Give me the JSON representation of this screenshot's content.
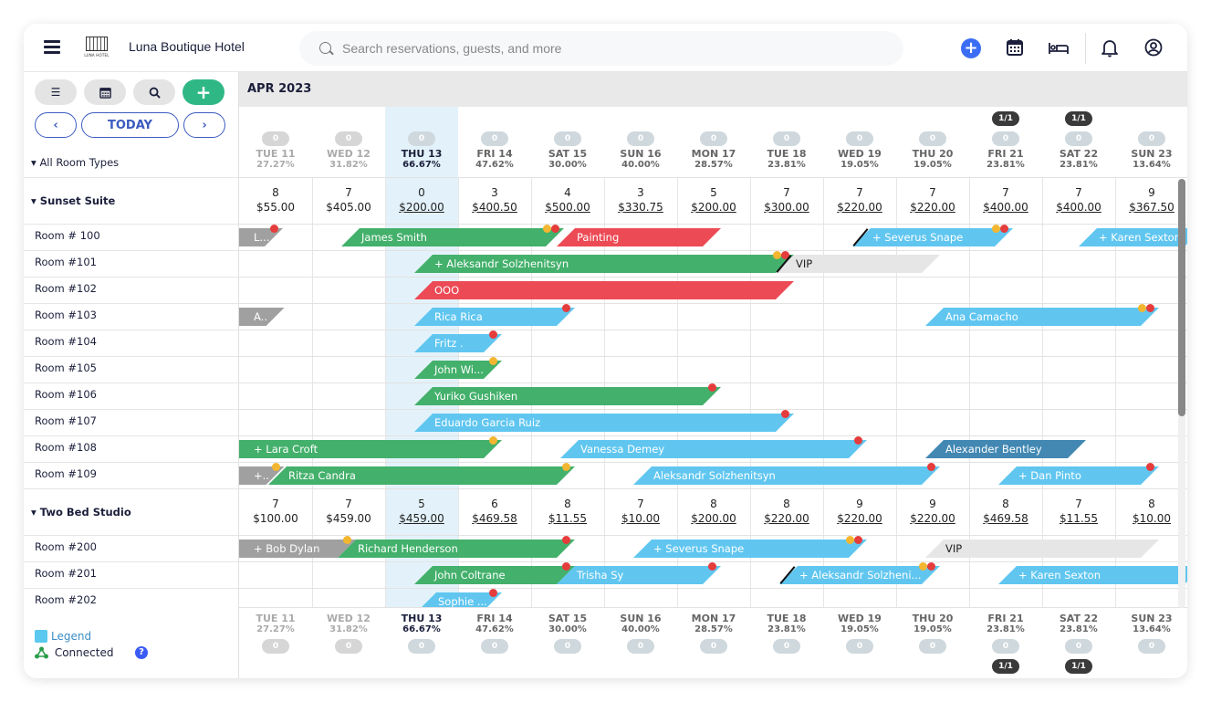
{
  "header": {
    "hotel_name": "Luna Boutique Hotel",
    "logo_text": "LUNA HOTEL",
    "search_placeholder": "Search reservations, guests, and more",
    "icons": [
      "menu-icon",
      "add-circle-icon",
      "calendar-icon",
      "bed-icon",
      "bell-icon",
      "user-circle-icon"
    ]
  },
  "toolbar": {
    "buttons": [
      "list-icon",
      "calendar-icon",
      "search-icon",
      "plus-icon"
    ],
    "prev_label": "‹",
    "today_label": "TODAY",
    "next_label": "›",
    "room_type_filter": "All Room Types"
  },
  "month_label": "APR 2023",
  "days": [
    {
      "label": "TUE 11",
      "pct": "27.27%",
      "count": "0",
      "state": "past",
      "badge": ""
    },
    {
      "label": "WED 12",
      "pct": "31.82%",
      "count": "0",
      "state": "past",
      "badge": ""
    },
    {
      "label": "THU 13",
      "pct": "66.67%",
      "count": "0",
      "state": "today",
      "badge": ""
    },
    {
      "label": "FRI 14",
      "pct": "47.62%",
      "count": "0",
      "state": "future",
      "badge": ""
    },
    {
      "label": "SAT 15",
      "pct": "30.00%",
      "count": "0",
      "state": "future",
      "badge": ""
    },
    {
      "label": "SUN 16",
      "pct": "40.00%",
      "count": "0",
      "state": "future",
      "badge": ""
    },
    {
      "label": "MON 17",
      "pct": "28.57%",
      "count": "0",
      "state": "future",
      "badge": ""
    },
    {
      "label": "TUE 18",
      "pct": "23.81%",
      "count": "0",
      "state": "future",
      "badge": ""
    },
    {
      "label": "WED 19",
      "pct": "19.05%",
      "count": "0",
      "state": "future",
      "badge": ""
    },
    {
      "label": "THU 20",
      "pct": "19.05%",
      "count": "0",
      "state": "future",
      "badge": ""
    },
    {
      "label": "FRI 21",
      "pct": "23.81%",
      "count": "0",
      "state": "future",
      "badge": "1/1"
    },
    {
      "label": "SAT 22",
      "pct": "23.81%",
      "count": "0",
      "state": "future",
      "badge": "1/1"
    },
    {
      "label": "SUN 23",
      "pct": "13.64%",
      "count": "0",
      "state": "future",
      "badge": ""
    }
  ],
  "room_groups": [
    {
      "name": "Sunset Suite",
      "availability": [
        {
          "count": "8",
          "price": "$55.00"
        },
        {
          "count": "7",
          "price": "$405.00"
        },
        {
          "count": "0",
          "price": "$200.00"
        },
        {
          "count": "3",
          "price": "$400.50"
        },
        {
          "count": "4",
          "price": "$500.00"
        },
        {
          "count": "3",
          "price": "$330.75"
        },
        {
          "count": "5",
          "price": "$200.00"
        },
        {
          "count": "7",
          "price": "$300.00"
        },
        {
          "count": "7",
          "price": "$220.00"
        },
        {
          "count": "7",
          "price": "$220.00"
        },
        {
          "count": "7",
          "price": "$400.00"
        },
        {
          "count": "7",
          "price": "$400.00"
        },
        {
          "count": "9",
          "price": "$367.50"
        }
      ],
      "rooms": [
        {
          "name": "Room # 100",
          "bookings": [
            {
              "label": "L...",
              "color": "gray",
              "start": 0,
              "end": 0.6,
              "flat_left": true,
              "dots": [
                "r"
              ]
            },
            {
              "label": "James Smith",
              "color": "green",
              "start": 1.4,
              "end": 4.45,
              "dots": [
                "y",
                "r"
              ]
            },
            {
              "label": "Painting",
              "color": "red",
              "start": 4.35,
              "end": 6.6,
              "dots": []
            },
            {
              "label": "+ Severus Snape",
              "color": "blue",
              "start": 8.4,
              "end": 10.6,
              "dots": [
                "y",
                "r"
              ],
              "slash": true
            },
            {
              "label": "+ Karen Sexton",
              "color": "blue",
              "start": 11.5,
              "end": 13.2,
              "dots": []
            }
          ]
        },
        {
          "name": "Room #101",
          "bookings": [
            {
              "label": "+ Aleksandr Solzhenitsyn",
              "color": "green",
              "start": 2.4,
              "end": 7.6,
              "dots": [
                "y",
                "r"
              ]
            },
            {
              "label": "VIP",
              "color": "vip",
              "start": 7.35,
              "end": 9.6,
              "dots": [],
              "slash": true
            }
          ]
        },
        {
          "name": "Room #102",
          "bookings": [
            {
              "label": "OOO",
              "color": "red",
              "start": 2.4,
              "end": 7.6,
              "dots": []
            }
          ]
        },
        {
          "name": "Room #103",
          "bookings": [
            {
              "label": "A..",
              "color": "gray",
              "start": 0,
              "end": 0.62,
              "flat_left": true,
              "dots": []
            },
            {
              "label": "Rica Rica",
              "color": "blue",
              "start": 2.4,
              "end": 4.6,
              "dots": [
                "r"
              ]
            },
            {
              "label": "Ana Camacho",
              "color": "blue",
              "start": 9.4,
              "end": 12.6,
              "dots": [
                "y",
                "r"
              ]
            }
          ]
        },
        {
          "name": "Room #104",
          "bookings": [
            {
              "label": "Fritz .",
              "color": "blue",
              "start": 2.4,
              "end": 3.6,
              "dots": [
                "r"
              ]
            }
          ]
        },
        {
          "name": "Room #105",
          "bookings": [
            {
              "label": "John Wi...",
              "color": "green",
              "start": 2.4,
              "end": 3.6,
              "dots": [
                "y"
              ]
            }
          ]
        },
        {
          "name": "Room #106",
          "bookings": [
            {
              "label": "Yuriko Gushiken",
              "color": "green",
              "start": 2.4,
              "end": 6.6,
              "dots": [
                "r"
              ]
            }
          ]
        },
        {
          "name": "Room #107",
          "bookings": [
            {
              "label": "Eduardo Garcia Ruiz",
              "color": "blue",
              "start": 2.4,
              "end": 7.6,
              "dots": [
                "r"
              ]
            }
          ]
        },
        {
          "name": "Room #108",
          "bookings": [
            {
              "label": "+ Lara Croft",
              "color": "green",
              "start": 0,
              "end": 3.6,
              "flat_left": true,
              "dots": [
                "y"
              ]
            },
            {
              "label": "Vanessa Demey",
              "color": "blue",
              "start": 4.4,
              "end": 8.6,
              "dots": [
                "r"
              ]
            },
            {
              "label": "Alexander Bentley",
              "color": "darkblue",
              "start": 9.4,
              "end": 11.6,
              "dots": []
            }
          ]
        },
        {
          "name": "Room #109",
          "bookings": [
            {
              "label": "+..",
              "color": "gray",
              "start": 0,
              "end": 0.62,
              "flat_left": true,
              "dots": [
                "y"
              ]
            },
            {
              "label": "Ritza Candra",
              "color": "green",
              "start": 0.4,
              "end": 4.6,
              "dots": [
                "y"
              ]
            },
            {
              "label": "Aleksandr Solzhenitsyn",
              "color": "blue",
              "start": 5.4,
              "end": 9.6,
              "dots": [
                "r"
              ]
            },
            {
              "label": "+ Dan Pinto",
              "color": "blue",
              "start": 10.4,
              "end": 12.6,
              "dots": [
                "r"
              ]
            }
          ]
        }
      ]
    },
    {
      "name": "Two Bed Studio",
      "availability": [
        {
          "count": "7",
          "price": "$100.00"
        },
        {
          "count": "7",
          "price": "$459.00"
        },
        {
          "count": "5",
          "price": "$459.00"
        },
        {
          "count": "6",
          "price": "$469.58"
        },
        {
          "count": "8",
          "price": "$11.55"
        },
        {
          "count": "7",
          "price": "$10.00"
        },
        {
          "count": "8",
          "price": "$200.00"
        },
        {
          "count": "8",
          "price": "$220.00"
        },
        {
          "count": "9",
          "price": "$220.00"
        },
        {
          "count": "9",
          "price": "$220.00"
        },
        {
          "count": "8",
          "price": "$469.58"
        },
        {
          "count": "7",
          "price": "$11.55"
        },
        {
          "count": "8",
          "price": "$10.00"
        }
      ],
      "rooms": [
        {
          "name": "Room #200",
          "bookings": [
            {
              "label": "+ Bob Dylan",
              "color": "gray",
              "start": 0,
              "end": 1.6,
              "flat_left": true,
              "dots": [
                "y"
              ]
            },
            {
              "label": "Richard Henderson",
              "color": "green",
              "start": 1.35,
              "end": 4.6,
              "dots": [
                "r"
              ]
            },
            {
              "label": "+ Severus Snape",
              "color": "blue",
              "start": 5.4,
              "end": 8.6,
              "dots": [
                "y",
                "r"
              ],
              "slash": false
            },
            {
              "label": "VIP",
              "color": "vip",
              "start": 9.4,
              "end": 12.6,
              "dots": []
            }
          ]
        },
        {
          "name": "Room #201",
          "bookings": [
            {
              "label": "John Coltrane",
              "color": "green",
              "start": 2.4,
              "end": 4.6,
              "dots": [
                "r"
              ]
            },
            {
              "label": "Trisha Sy",
              "color": "blue",
              "start": 4.35,
              "end": 6.6,
              "dots": [
                "r"
              ]
            },
            {
              "label": "+ Aleksandr Solzheni...",
              "color": "blue",
              "start": 7.4,
              "end": 9.6,
              "dots": [
                "y",
                "r"
              ],
              "slash": true
            },
            {
              "label": "+ Karen Sexton",
              "color": "blue",
              "start": 10.4,
              "end": 13.2,
              "dots": []
            }
          ]
        },
        {
          "name": "Room #202",
          "bookings": [
            {
              "label": "Sophie ...",
              "color": "blue",
              "start": 2.45,
              "end": 3.6,
              "dots": [
                "r"
              ]
            }
          ]
        }
      ]
    }
  ],
  "legend": {
    "legend_label": "Legend",
    "connected_label": "Connected",
    "help_label": "?"
  },
  "colors": {
    "green": "#43b06b",
    "red": "#ec4a55",
    "blue": "#60c6f0",
    "darkblue": "#4288b3",
    "gray": "#a0a0a0",
    "vip": "#e6e6e6",
    "accent": "#2fb886",
    "nav": "#3b5bbf"
  }
}
